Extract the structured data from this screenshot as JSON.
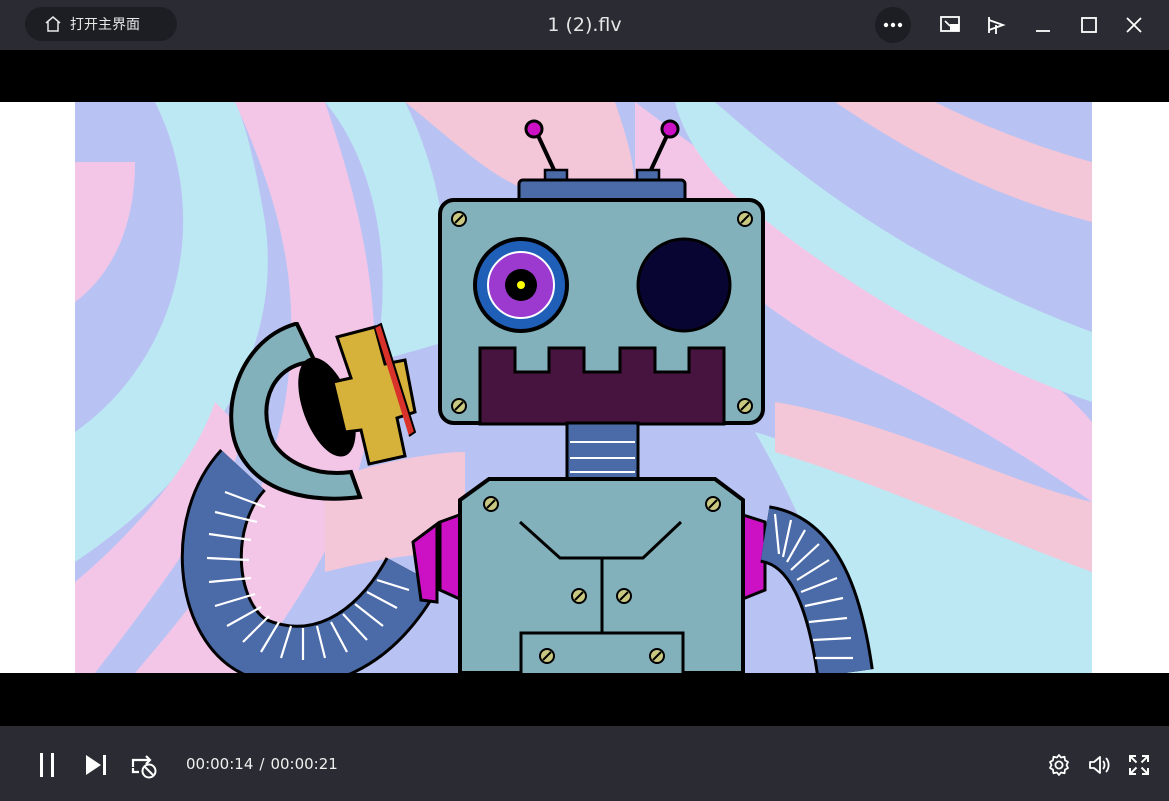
{
  "titlebar": {
    "home_label": "打开主界面",
    "file_title": "1 (2).flv",
    "icons": [
      "home-icon",
      "more-icon",
      "mini-mode-icon",
      "pin-on-top-icon",
      "minimize-icon",
      "maximize-icon",
      "close-icon"
    ]
  },
  "controls": {
    "current_time": "00:00:14",
    "separator": "/",
    "duration": "00:00:21",
    "icons": [
      "pause-icon",
      "next-icon",
      "loop-off-icon",
      "settings-icon",
      "volume-icon",
      "fullscreen-icon"
    ]
  },
  "colors": {
    "titlebar_bg": "#2b2c33",
    "control_bg": "#2b2c33",
    "robot_body": "#82b1bc",
    "robot_mouth": "#46143e",
    "robot_arm": "#4a6aa8",
    "joint_magenta": "#cc11c4",
    "pupil_yellow": "#ffff00"
  }
}
